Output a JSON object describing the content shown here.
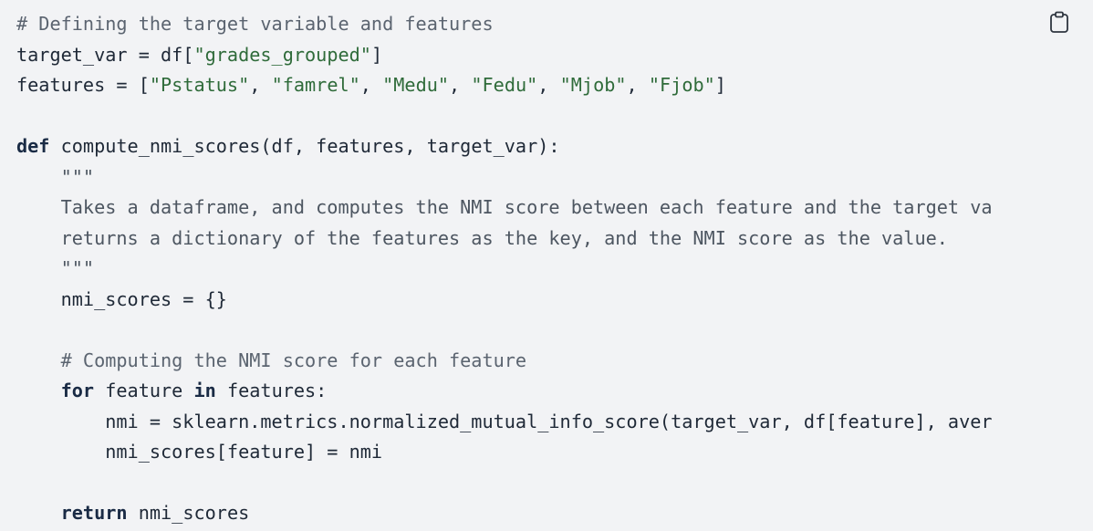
{
  "code_block": {
    "copy_label": "copy-icon",
    "lines": [
      [
        {
          "t": "comment",
          "v": "# Defining the target variable and features"
        }
      ],
      [
        {
          "t": "plain",
          "v": "target_var = df["
        },
        {
          "t": "string",
          "v": "\"grades_grouped\""
        },
        {
          "t": "plain",
          "v": "]"
        }
      ],
      [
        {
          "t": "plain",
          "v": "features = ["
        },
        {
          "t": "string",
          "v": "\"Pstatus\""
        },
        {
          "t": "plain",
          "v": ", "
        },
        {
          "t": "string",
          "v": "\"famrel\""
        },
        {
          "t": "plain",
          "v": ", "
        },
        {
          "t": "string",
          "v": "\"Medu\""
        },
        {
          "t": "plain",
          "v": ", "
        },
        {
          "t": "string",
          "v": "\"Fedu\""
        },
        {
          "t": "plain",
          "v": ", "
        },
        {
          "t": "string",
          "v": "\"Mjob\""
        },
        {
          "t": "plain",
          "v": ", "
        },
        {
          "t": "string",
          "v": "\"Fjob\""
        },
        {
          "t": "plain",
          "v": "]"
        }
      ],
      [],
      [
        {
          "t": "keyword",
          "v": "def"
        },
        {
          "t": "plain",
          "v": " compute_nmi_scores(df, features, target_var):"
        }
      ],
      [
        {
          "t": "docstring",
          "v": "    \"\"\""
        }
      ],
      [
        {
          "t": "docstring",
          "v": "    Takes a dataframe, and computes the NMI score between each feature and the target va"
        }
      ],
      [
        {
          "t": "docstring",
          "v": "    returns a dictionary of the features as the key, and the NMI score as the value."
        }
      ],
      [
        {
          "t": "docstring",
          "v": "    \"\"\""
        }
      ],
      [
        {
          "t": "plain",
          "v": "    nmi_scores = {}"
        }
      ],
      [],
      [
        {
          "t": "comment",
          "v": "    # Computing the NMI score for each feature"
        }
      ],
      [
        {
          "t": "plain",
          "v": "    "
        },
        {
          "t": "keyword",
          "v": "for"
        },
        {
          "t": "plain",
          "v": " feature "
        },
        {
          "t": "keyword",
          "v": "in"
        },
        {
          "t": "plain",
          "v": " features:"
        }
      ],
      [
        {
          "t": "plain",
          "v": "        nmi = sklearn.metrics.normalized_mutual_info_score(target_var, df[feature], aver"
        }
      ],
      [
        {
          "t": "plain",
          "v": "        nmi_scores[feature] = nmi"
        }
      ],
      [],
      [
        {
          "t": "plain",
          "v": "    "
        },
        {
          "t": "keyword",
          "v": "return"
        },
        {
          "t": "plain",
          "v": " nmi_scores"
        }
      ]
    ]
  }
}
